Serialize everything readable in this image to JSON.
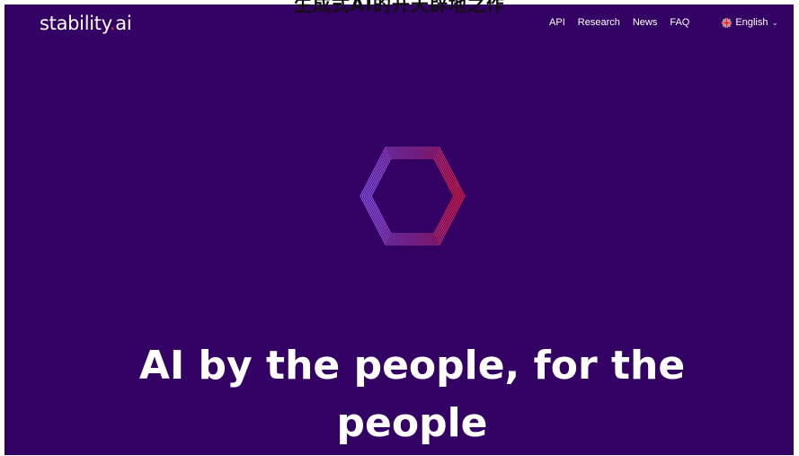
{
  "caption": "生成式AI的开天辟地之作",
  "brand": {
    "name_start": "stability",
    "name_dot": ".",
    "name_end": "ai"
  },
  "nav": {
    "items": [
      {
        "label": "API"
      },
      {
        "label": "Research"
      },
      {
        "label": "News"
      },
      {
        "label": "FAQ"
      }
    ],
    "language": "English"
  },
  "hero": {
    "line1": "AI by the people, for the",
    "line2": "people"
  },
  "colors": {
    "background": "#330063",
    "brand_dot": "#e8293a",
    "hex_left": "#8a5cf0",
    "hex_right": "#e0203a"
  }
}
